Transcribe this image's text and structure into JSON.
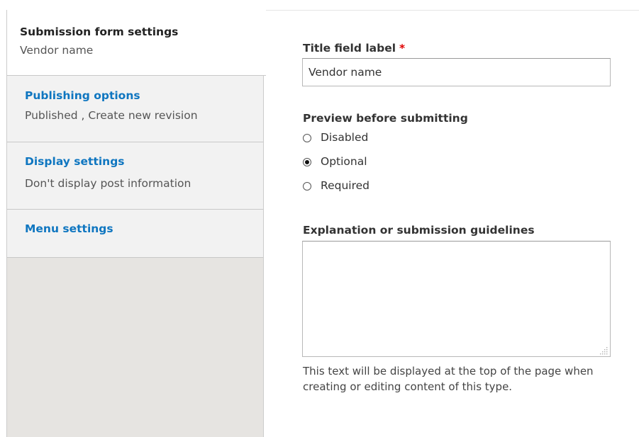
{
  "vertical_tabs": [
    {
      "title": "Submission form settings",
      "summary": "Vendor name"
    },
    {
      "title": "Publishing options",
      "summary": "Published , Create new revision"
    },
    {
      "title": "Display settings",
      "summary": "Don't display post information"
    },
    {
      "title": "Menu settings",
      "summary": ""
    }
  ],
  "title_field": {
    "label": "Title field label",
    "required_marker": "*",
    "value": "Vendor name"
  },
  "preview": {
    "label": "Preview before submitting",
    "options": [
      {
        "label": "Disabled",
        "checked": false
      },
      {
        "label": "Optional",
        "checked": true
      },
      {
        "label": "Required",
        "checked": false
      }
    ]
  },
  "guidelines": {
    "label": "Explanation or submission guidelines",
    "value": "",
    "description": "This text will be displayed at the top of the page when creating or editing content of this type."
  },
  "colors": {
    "link_blue": "#0f76c0",
    "required_red": "#e00000",
    "tab_pane_bg": "#e6e4e1"
  }
}
